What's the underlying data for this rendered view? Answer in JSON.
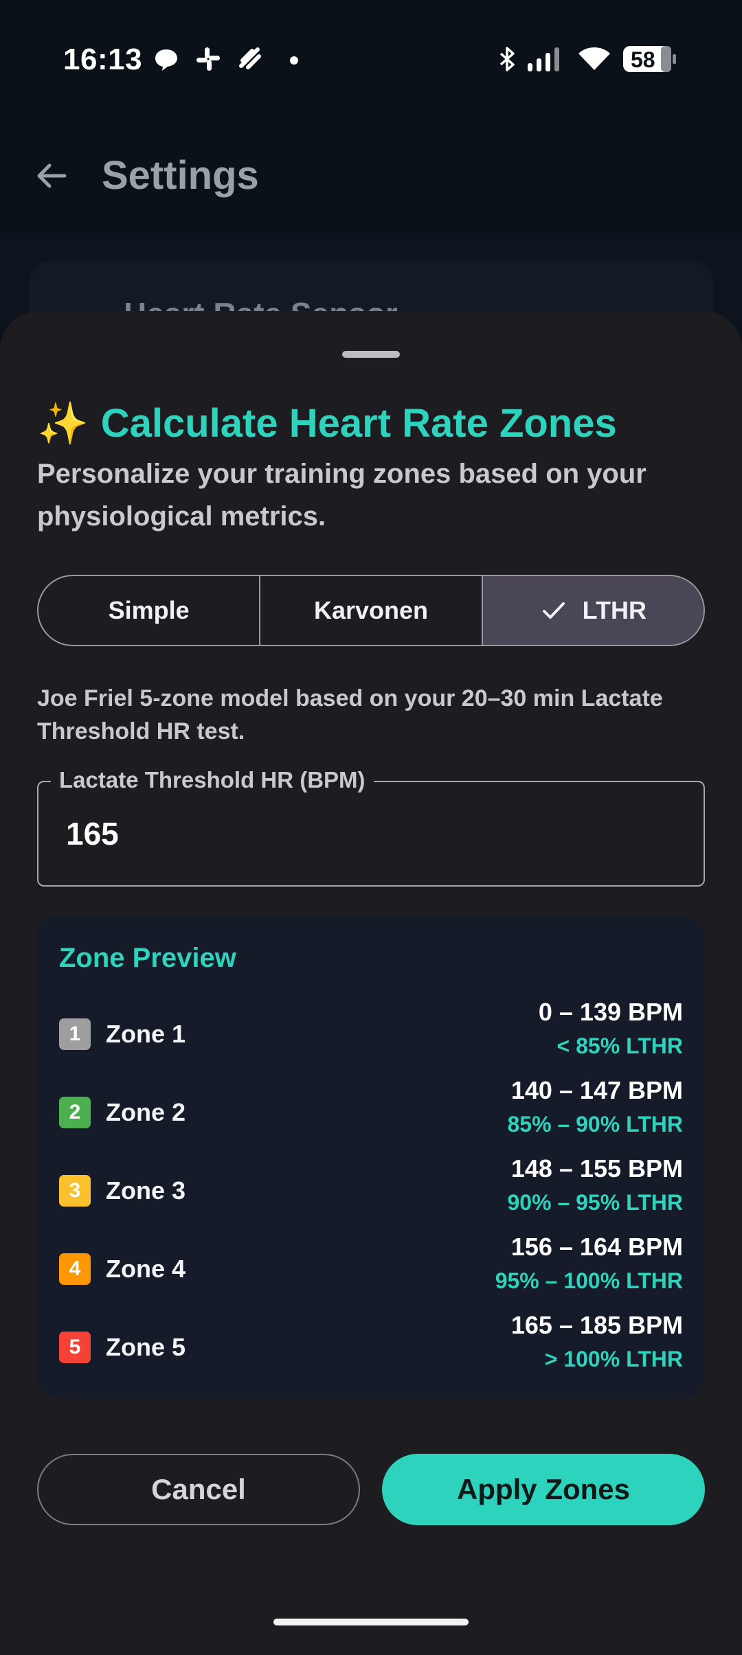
{
  "status_bar": {
    "time": "16:13",
    "battery": "58",
    "icons": [
      "chat-bubble-icon",
      "slack-icon",
      "notification-icon",
      "dot-icon",
      "bluetooth-icon",
      "signal-icon",
      "wifi-icon",
      "battery-icon"
    ]
  },
  "app_bar": {
    "title": "Settings",
    "background_item": "Heart Rate Sensor"
  },
  "sheet": {
    "title_emoji": "✨",
    "title": "Calculate Heart Rate Zones",
    "subtitle": "Personalize your training zones based on your physiological metrics.",
    "methods": [
      {
        "label": "Simple",
        "selected": false
      },
      {
        "label": "Karvonen",
        "selected": false
      },
      {
        "label": "LTHR",
        "selected": true
      }
    ],
    "description": "Joe Friel 5-zone model based on your 20–30 min Lactate Threshold HR test.",
    "field": {
      "label": "Lactate Threshold HR (BPM)",
      "value": "165"
    },
    "preview": {
      "title": "Zone Preview",
      "zones": [
        {
          "number": "1",
          "name": "Zone 1",
          "bpm": "0 – 139 BPM",
          "pct": "< 85% LTHR",
          "color": "#9e9e9e"
        },
        {
          "number": "2",
          "name": "Zone 2",
          "bpm": "140 – 147 BPM",
          "pct": "85% – 90% LTHR",
          "color": "#4caf50"
        },
        {
          "number": "3",
          "name": "Zone 3",
          "bpm": "148 – 155 BPM",
          "pct": "90% – 95% LTHR",
          "color": "#fbc02d"
        },
        {
          "number": "4",
          "name": "Zone 4",
          "bpm": "156 – 164 BPM",
          "pct": "95% – 100% LTHR",
          "color": "#ff9800"
        },
        {
          "number": "5",
          "name": "Zone 5",
          "bpm": "165 – 185 BPM",
          "pct": "> 100% LTHR",
          "color": "#f44336"
        }
      ]
    },
    "cancel_label": "Cancel",
    "apply_label": "Apply Zones"
  },
  "colors": {
    "accent": "#2ed3be",
    "sheet_bg": "#1d1c20",
    "card_bg": "#151b28"
  }
}
